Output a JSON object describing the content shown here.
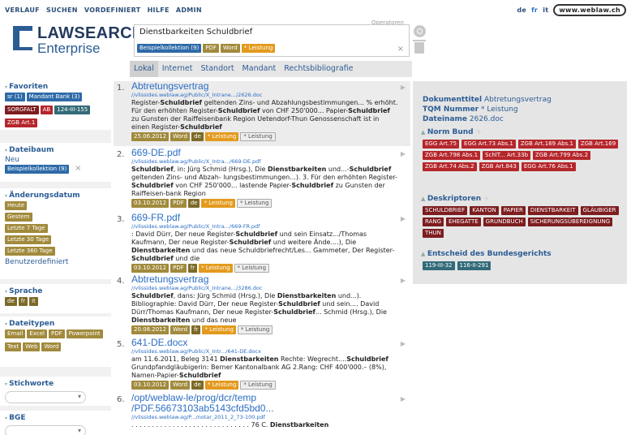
{
  "menu": [
    "VERLAUF",
    "SUCHEN",
    "VORDEFINIERT",
    "HILFE",
    "ADMIN"
  ],
  "languages": [
    {
      "code": "de",
      "active": false
    },
    {
      "code": "fr",
      "active": true
    },
    {
      "code": "it",
      "active": false
    }
  ],
  "weblaw_badge": "www.weblaw.ch",
  "logo": {
    "line1": "LAWSEARCH",
    "line2": "Enterprise"
  },
  "operators_label": "Operatoren",
  "search": {
    "query": "Dienstbarkeiten Schuldbrief",
    "chips": [
      {
        "label": "Beispielkollektion (9)",
        "color": "blue"
      },
      {
        "label": "PDF",
        "color": "olive"
      },
      {
        "label": "Word",
        "color": "olive"
      },
      {
        "label": "* Leistung",
        "color": "orange"
      }
    ],
    "clear": "×"
  },
  "tabs": [
    {
      "label": "Lokal",
      "active": true
    },
    {
      "label": "Internet",
      "active": false
    },
    {
      "label": "Standort",
      "active": false
    },
    {
      "label": "Mandant",
      "active": false
    },
    {
      "label": "Rechtsbibliografie",
      "active": false
    }
  ],
  "sidebar": {
    "favoriten": {
      "title": "Favoriten",
      "chips": [
        {
          "label": "sr (1)",
          "color": "blue"
        },
        {
          "label": "Mandant Bank (3)",
          "color": "blue"
        },
        {
          "label": "SORGFALT",
          "color": "dred"
        },
        {
          "label": "AB",
          "color": "red"
        },
        {
          "label": "124-III-155",
          "color": "teal"
        },
        {
          "label": "ZGB Art.1",
          "color": "red"
        }
      ]
    },
    "dateibaum": {
      "title": "Dateibaum",
      "link": "Neu",
      "chip": "Beispielkollektion (9)",
      "remove": "×"
    },
    "aenderung": {
      "title": "Änderungsdatum",
      "items": [
        "Heute",
        "Gestern",
        "Letzte 7 Tage",
        "Letzte 30 Tage",
        "Letzte 360 Tage"
      ],
      "custom": "Benutzerdefiniert"
    },
    "sprache": {
      "title": "Sprache",
      "items": [
        "de",
        "fr",
        "it"
      ]
    },
    "dateitypen": {
      "title": "Dateitypen",
      "items": [
        "Email",
        "Excel",
        "PDF",
        "Powerpoint",
        "Text",
        "Web",
        "Word"
      ]
    },
    "stichworte": {
      "title": "Stichworte"
    },
    "bge": {
      "title": "BGE"
    }
  },
  "results": [
    {
      "num": "1.",
      "title": "Abtretungsvertrag",
      "url": "//vlissides.weblaw.ag/Public/X_Intrane.../2626.doc",
      "snippet": "Register-<b>Schuldbrief</b> geltenden Zins- und Abzahlungsbestimmungen... % erhöht. Für den erhöhten Register-<b>Schuldbrief</b> von CHF 250'000... Papier-<b>Schuldbrief</b> zu Gunsten der Raiffeisenbank Region Uetendorf-Thun Genossenschaft ist in einen Register-<b>Schuldbrief</b>",
      "date": "25.06.2012",
      "type": "Word",
      "lang": "de",
      "tags": [
        "* Leistung",
        "* Leistung"
      ]
    },
    {
      "num": "2.",
      "title": "669-DE.pdf",
      "url": "//vlissides.weblaw.ag/Public/X_Intra.../669-DE.pdf",
      "snippet": "<b>Schuldbrief</b>, in: Jürg Schmid (Hrsg.), Die <b>Dienstbarkeiten</b> und...-<b>Schuldbrief</b> geltenden Zins- und Abzah- lungsbestimmungen...). 3. Für den erhöhten Register-<b>Schuldbrief</b> von CHF 250'000... lastende Papier-<b>Schuldbrief</b> zu Gunsten der Raiffeisen-bank Region",
      "date": "03.10.2012",
      "type": "PDF",
      "lang": "de",
      "tags": [
        "* Leistung",
        "* Leistung"
      ]
    },
    {
      "num": "3.",
      "title": "669-FR.pdf",
      "url": "//vlissides.weblaw.ag/Public/X_Intra.../669-FR.pdf",
      "snippet": ": David Dürr, Der neue Register-<b>Schuldbrief</b> und sein Einsatz.../Thomas Kaufmann, Der neue Register-<b>Schuldbrief</b> und weitere Ände....), Die <b>Dienstbarkeiten</b> und das neue Schuldbriefrecht/Les... Gammeter, Der Register-<b>Schuldbrief</b> und die",
      "date": "03.10.2012",
      "type": "PDF",
      "lang": "fr",
      "tags": [
        "* Leistung",
        "* Leistung"
      ]
    },
    {
      "num": "4.",
      "title": "Abtretungsvertrag",
      "url": "//vlissides.weblaw.ag/Public/X_Intrane.../3286.doc",
      "snippet": "<b>Schuldbrief</b>, dans: Jürg Schmid (Hrsg.), Die <b>Dienstbarkeiten</b> und...). Bibliographie: David Dürr, Der neue Register-<b>Schuldbrief</b> und sein.... David Dürr/Thomas Kaufmann, Der neue Register-<b>Schuldbrief</b>... Schmid (Hrsg.), Die <b>Dienstbarkeiten</b> und das neue",
      "date": "20.08.2012",
      "type": "Word",
      "lang": "fr",
      "tags": [
        "* Leistung",
        "* Leistung"
      ]
    },
    {
      "num": "5.",
      "title": "641-DE.docx",
      "url": "//vlissides.weblaw.ag/Public/X_Intr.../641-DE.docx",
      "snippet": "am 11.6.2011, Beleg 3141 <b>Dienstbarkeiten</b> Rechte: Wegrecht....<b>Schuldbrief</b> Grundpfandgläubigerin: Berner Kantonalbank AG 2.Rang: CHF 400'000.– (8%), Namen-Papier-<b>Schuldbrief</b>",
      "date": "03.10.2012",
      "type": "Word",
      "lang": "de",
      "tags": [
        "* Leistung",
        "* Leistung"
      ]
    },
    {
      "num": "6.",
      "title": "/opt/weblaw-le/prog/dcr/temp /PDF.56673103ab5143cfd5bd0...",
      "url": "//vlissides.weblaw.ag/P.../notar_2011_2_73-100.pdf",
      "snippet": ". . . . . . . . . . . . . . . . . . . . . . . . . . . . . 76 C. <b>Dienstbarkeiten</b>",
      "date": "",
      "type": "",
      "lang": "",
      "tags": []
    }
  ],
  "detail": {
    "doc_title_label": "Dokumenttitel",
    "doc_title": "Abtretungsvertrag",
    "tqm_label": "TQM Nummer",
    "tqm": "* Leistung",
    "file_label": "Dateiname",
    "file": "2626.doc",
    "norm_title": "Norm Bund",
    "norm_chips": [
      "EGG Art.75",
      "EGG Art.73 Abs.1",
      "ZGB Art.169 Abs.1",
      "ZGB Art.169",
      "ZGB Art.798 Abs.1",
      "SchlT... Art.33b",
      "ZGB Art.799 Abs.2",
      "ZGB Art.74 Abs.2",
      "ZGB Art.843",
      "EGG Art.76 Abs.1"
    ],
    "desk_title": "Deskriptoren",
    "desk_chips": [
      "SCHULDBRIEF",
      "KANTON",
      "PAPIER",
      "DIENSTBARKEIT",
      "GLÄUBIGER",
      "RANG",
      "EHEGATTE",
      "GRUNDBUCH",
      "SICHERUNGSÜBEREIGNUNG",
      "THUN"
    ],
    "bg_title": "Entscheid des Bundesgerichts",
    "bg_chips": [
      "119-III-32",
      "116-II-291"
    ]
  }
}
